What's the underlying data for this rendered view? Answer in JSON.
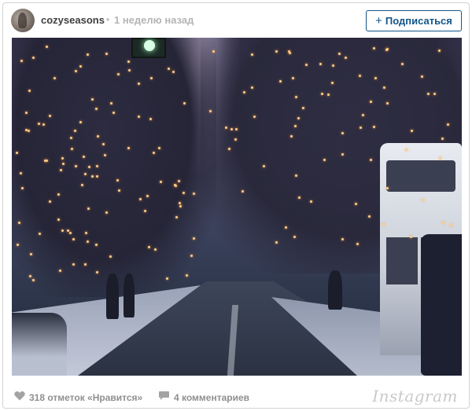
{
  "post": {
    "username": "cozyseasons",
    "separator": "•",
    "time": "1 неделю назад",
    "follow_label": "Подписаться",
    "follow_icon": "plus-icon"
  },
  "footer": {
    "likes": "318 отметок «Нравится»",
    "comments": "4 комментариев",
    "brand": "Instagram",
    "like_icon": "heart-icon",
    "comment_icon": "comment-bubble-icon"
  },
  "colors": {
    "accent": "#125688",
    "muted_text": "#8f8f8f"
  }
}
